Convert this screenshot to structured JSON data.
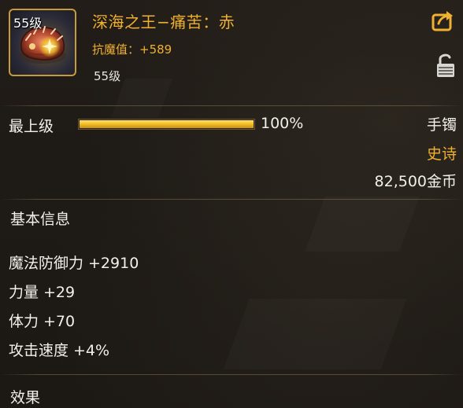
{
  "item": {
    "level_badge": "55级",
    "name": "深海之王−痛苦：赤",
    "resist_label": "抗魔值：",
    "resist_value": "+589",
    "required_level": "55级"
  },
  "icons": {
    "item": "crab-armor-icon",
    "share": "share-arrow-icon",
    "lock": "unlock-icon"
  },
  "upgrade": {
    "label": "最上级",
    "progress_percent": 100,
    "progress_text": "100%"
  },
  "meta": {
    "slot_type": "手镯",
    "rarity": "史诗",
    "price": "82,500金币"
  },
  "sections": {
    "basic_info": "基本信息",
    "effects": "效果"
  },
  "stats": [
    {
      "name": "魔法防御力",
      "value": "+2910"
    },
    {
      "name": "力量",
      "value": "+29"
    },
    {
      "name": "体力",
      "value": "+70"
    },
    {
      "name": "攻击速度",
      "value": "+4%"
    }
  ],
  "colors": {
    "epic_gold": "#f0b030",
    "text": "#f2f0ea",
    "progress_fill": "#f3c02a"
  }
}
